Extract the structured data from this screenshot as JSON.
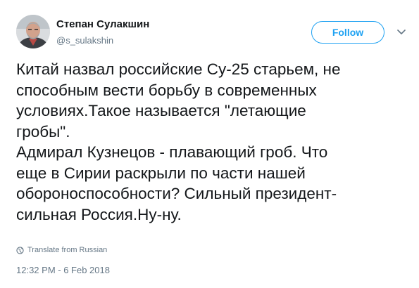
{
  "author": {
    "name": "Степан Сулакшин",
    "handle": "@s_sulakshin",
    "avatar_icon": "user-portrait-photo"
  },
  "follow_button_label": "Follow",
  "tweet": {
    "lines": [
      "Китай назвал российские Су-25 старьем, не",
      "способным вести борьбу в современных",
      "условиях.Такое называется \"летающие",
      "гробы\".",
      "Адмирал Кузнецов - плавающий гроб. Что",
      "еще в Сирии раскрыли по части нашей",
      "обороноспособности? Сильный президент-",
      "сильная Россия.Ну-ну."
    ]
  },
  "translate_label": "Translate from Russian",
  "timestamp": "12:32 PM - 6 Feb 2018",
  "colors": {
    "accent": "#1da1f2",
    "text": "#14171a",
    "secondary": "#657786"
  }
}
